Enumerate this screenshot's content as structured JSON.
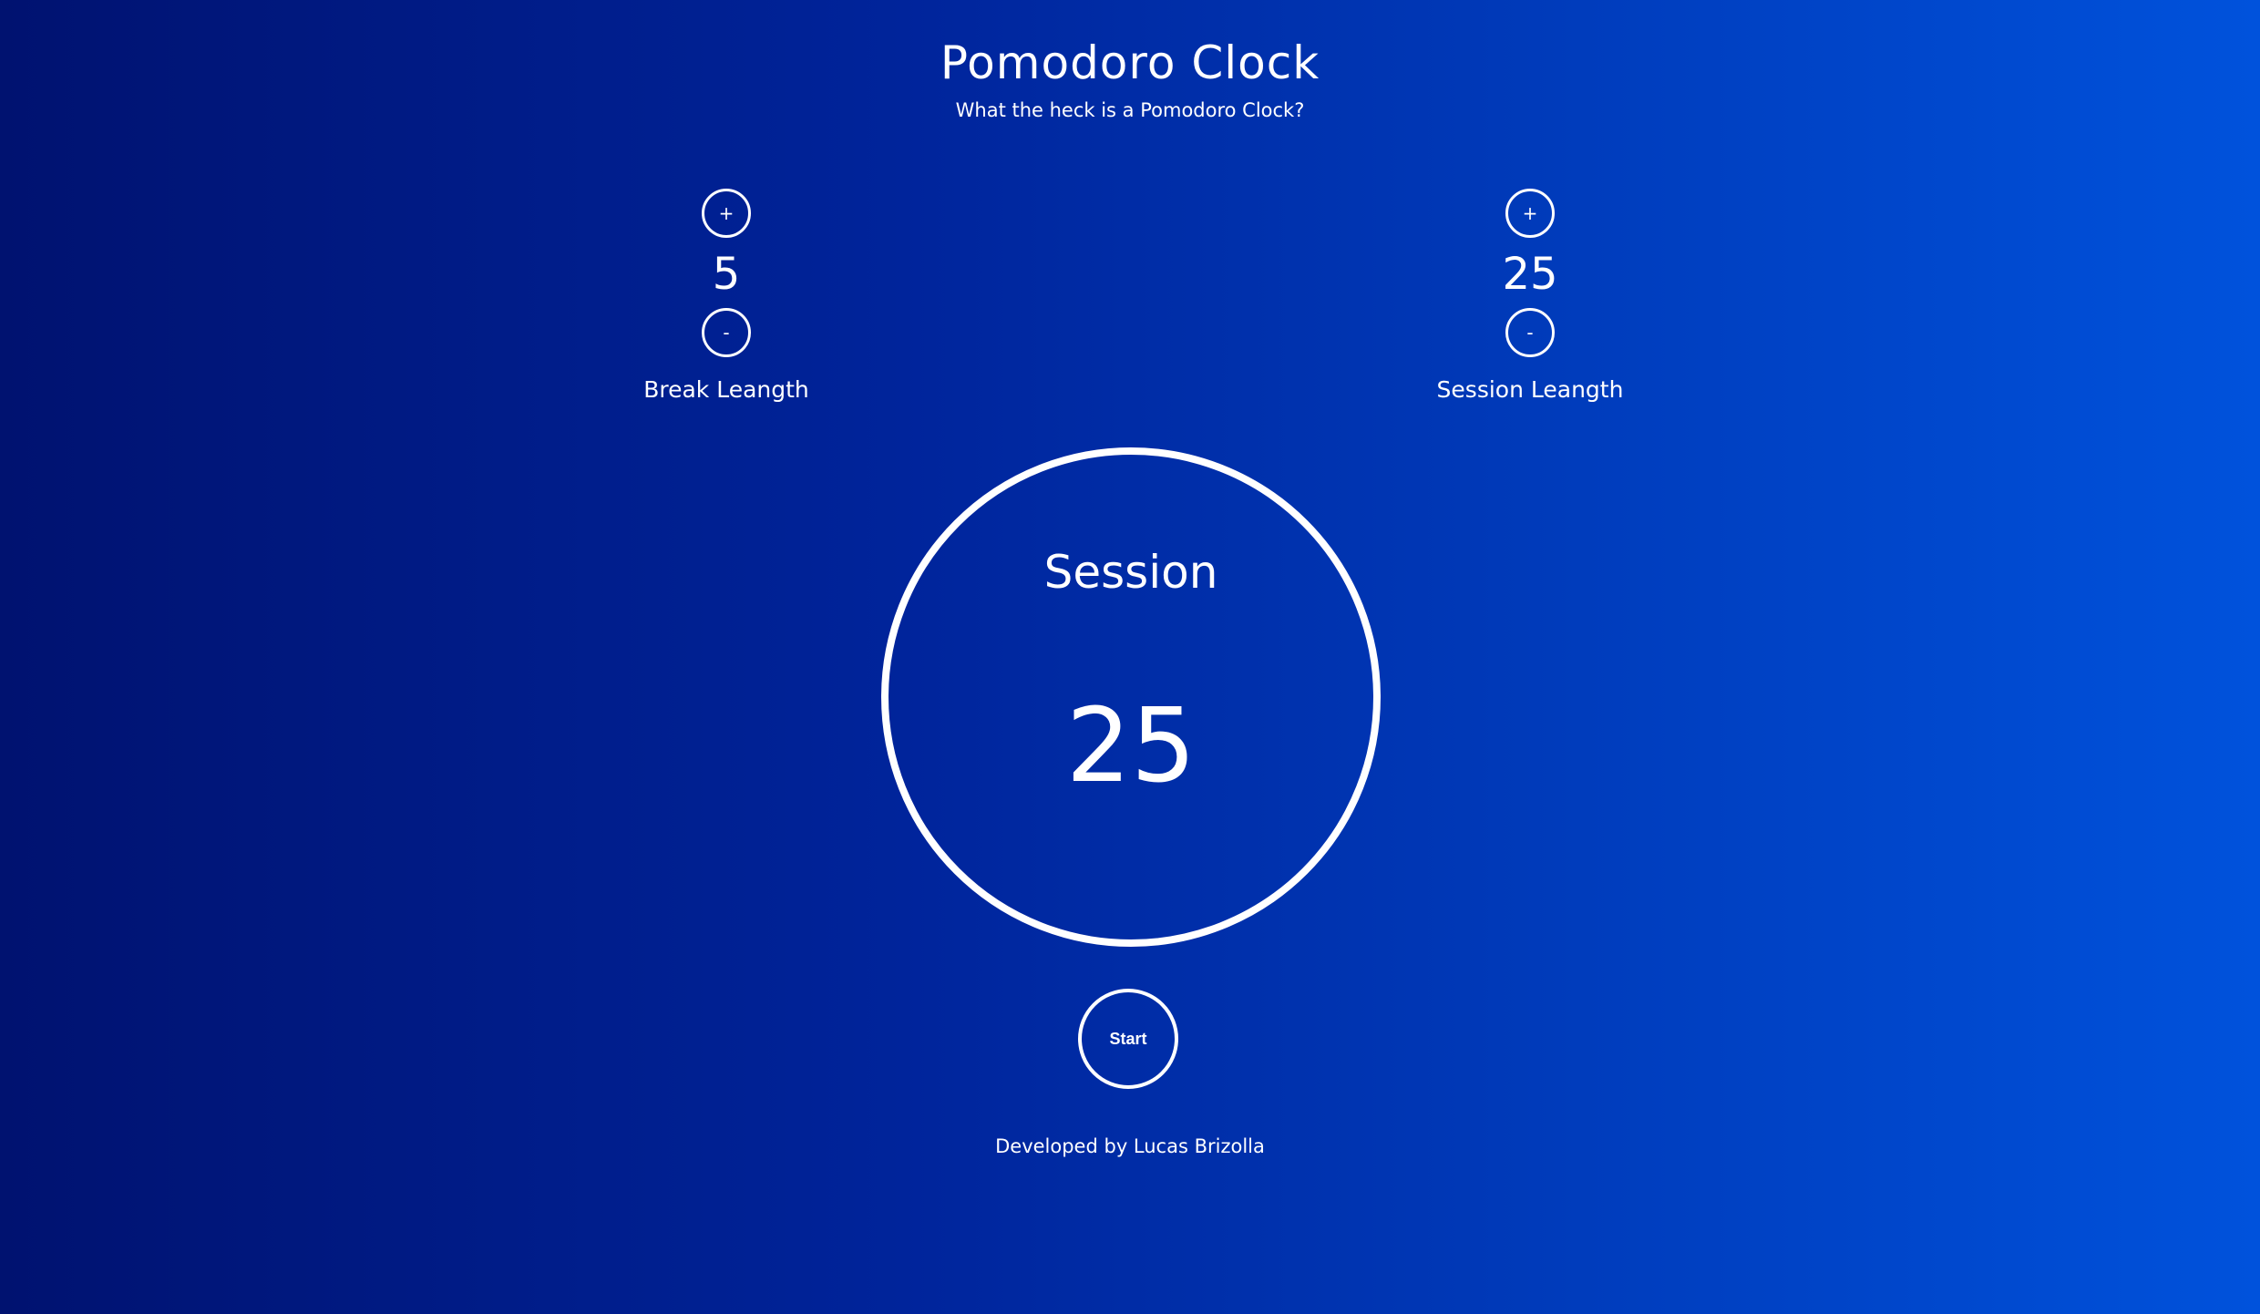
{
  "header": {
    "title": "Pomodoro Clock",
    "subtitle": "What the heck is a Pomodoro Clock?"
  },
  "break_control": {
    "increment_label": "+",
    "value": "5",
    "decrement_label": "-",
    "label": "Break Leangth"
  },
  "session_control": {
    "increment_label": "+",
    "value": "25",
    "decrement_label": "-",
    "label": "Session Leangth"
  },
  "timer": {
    "mode_label": "Session",
    "value": "25"
  },
  "start_button": {
    "label": "Start"
  },
  "footer": {
    "credit": "Developed by Lucas Brizolla"
  },
  "colors": {
    "background_left": "#001270",
    "background_right": "#0052dc",
    "foreground": "#ffffff"
  }
}
